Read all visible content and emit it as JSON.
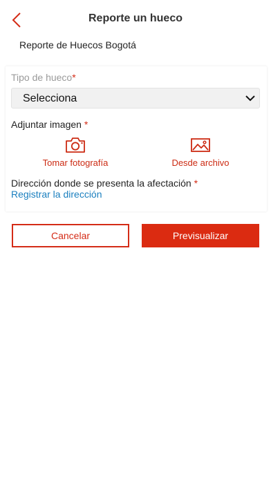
{
  "header": {
    "title": "Reporte un hueco"
  },
  "subtitle": "Reporte de Huecos Bogotá",
  "form": {
    "type_label": "Tipo de hueco",
    "type_required": "*",
    "type_select_value": "Selecciona",
    "attach_label": "Adjuntar imagen ",
    "attach_required": "*",
    "camera_label": "Tomar fotografía",
    "file_label": "Desde archivo",
    "address_label": "Dirección donde se presenta la afectación ",
    "address_required": "*",
    "address_link": "Registrar la dirección"
  },
  "buttons": {
    "cancel": "Cancelar",
    "preview": "Previsualizar"
  },
  "icons": {
    "back": "chevron-left-icon",
    "dropdown": "chevron-down-icon",
    "camera": "camera-icon",
    "gallery": "image-icon"
  },
  "colors": {
    "accent": "#db2b11",
    "link": "#1a7fbf"
  }
}
